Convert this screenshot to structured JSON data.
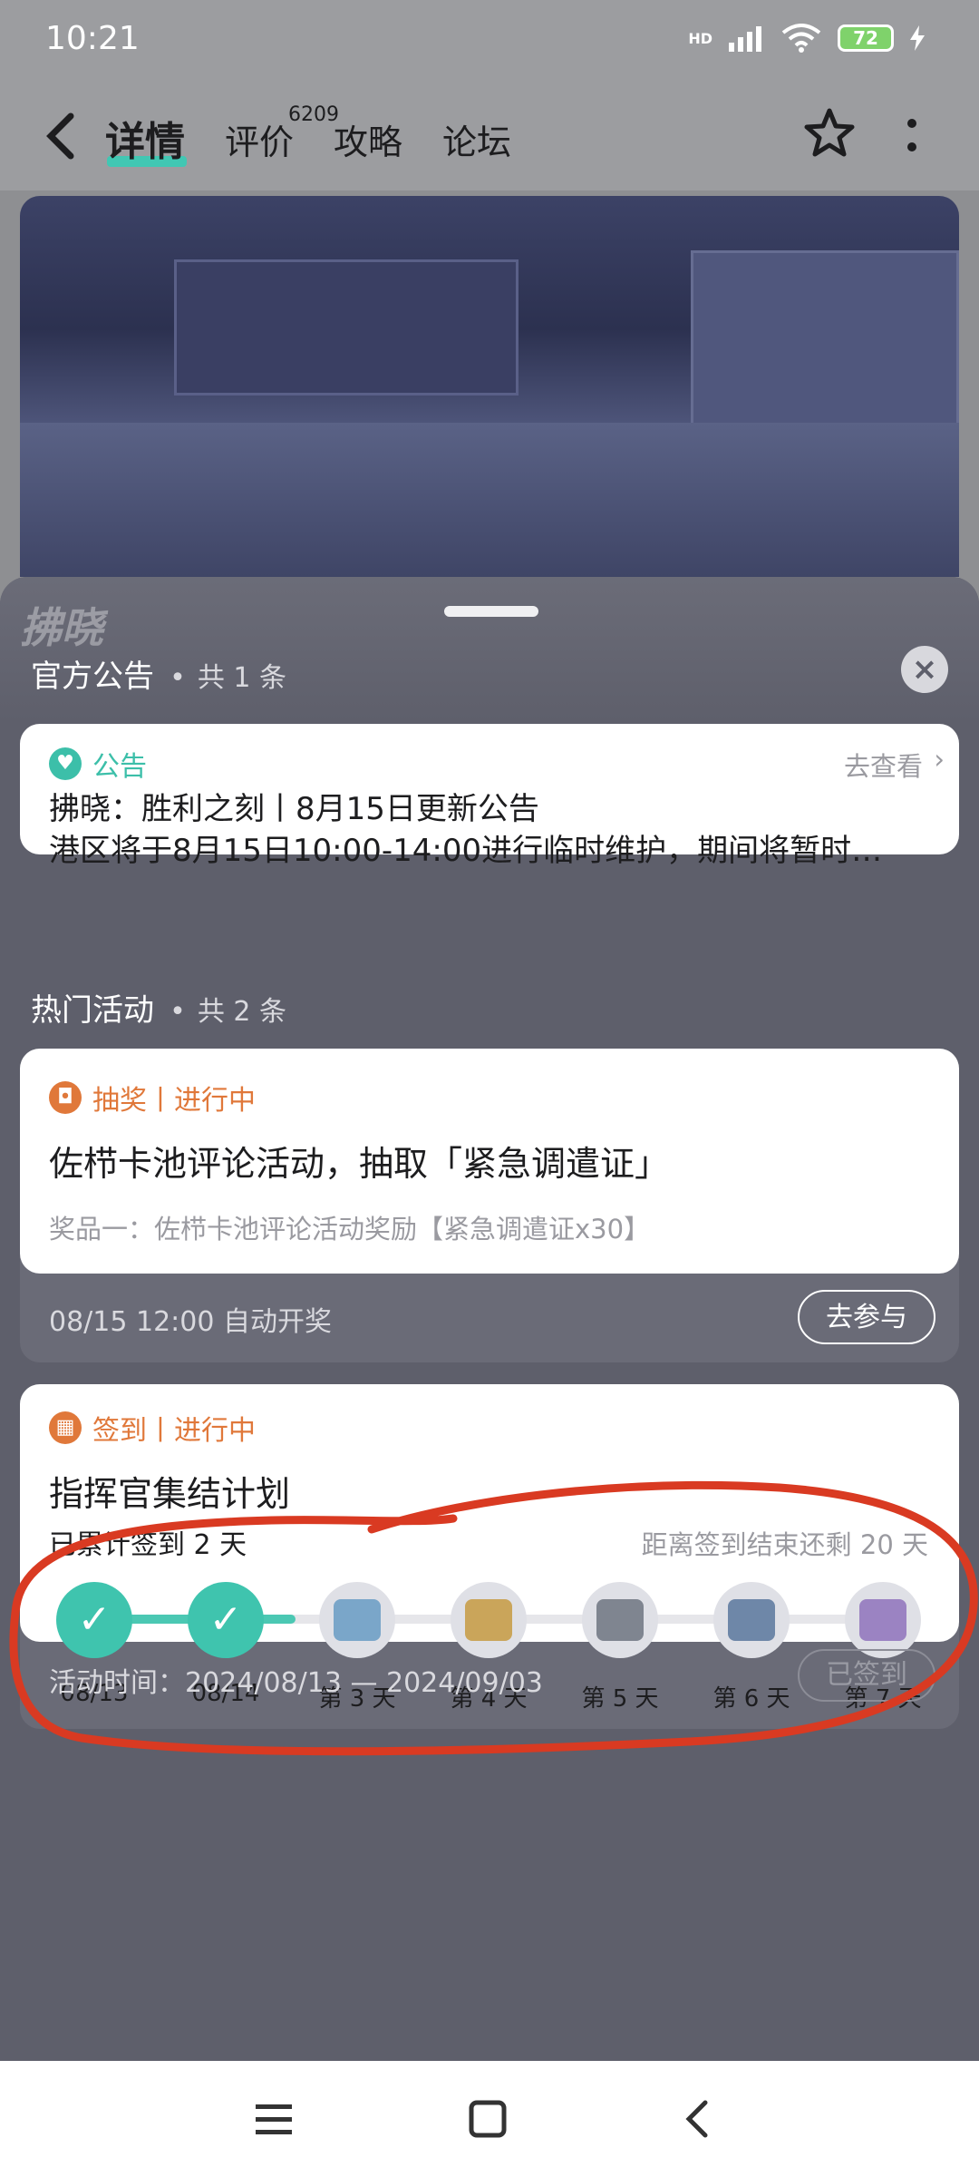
{
  "status_bar": {
    "time": "10:21",
    "battery": "72",
    "network": "HD"
  },
  "nav": {
    "tabs": [
      "详情",
      "评价",
      "攻略",
      "论坛"
    ],
    "review_badge": "6209"
  },
  "watermark": "拂晓",
  "announcements": {
    "title": "官方公告",
    "count": "共 1 条",
    "card": {
      "tag": "公告",
      "link": "去查看",
      "headline": "拂晓：胜利之刻丨8月15日更新公告",
      "summary": "港区将于8月15日10:00-14:00进行临时维护，期间将暂时…"
    }
  },
  "activities": {
    "title": "热门活动",
    "count": "共 2 条",
    "lottery": {
      "tag": "抽奖丨进行中",
      "title": "佐栉卡池评论活动，抽取「紧急调遣证」",
      "prize": "奖品一：佐栉卡池评论活动奖励【紧急调遣证x30】",
      "draw_time": "08/15 12:00 自动开奖",
      "button": "去参与"
    },
    "checkin": {
      "tag": "签到丨进行中",
      "title": "指挥官集结计划",
      "accumulated": "已累计签到 2 天",
      "remaining": "距离签到结束还剩 20 天",
      "days": [
        {
          "label": "08/13",
          "done": true,
          "icon": "check-icon"
        },
        {
          "label": "08/14",
          "done": true,
          "icon": "check-icon"
        },
        {
          "label": "第 3 天",
          "done": false,
          "icon": "card-pack-icon"
        },
        {
          "label": "第 4 天",
          "done": false,
          "icon": "chest-icon"
        },
        {
          "label": "第 5 天",
          "done": false,
          "icon": "ammo-icon"
        },
        {
          "label": "第 6 天",
          "done": false,
          "icon": "ticket-icon"
        },
        {
          "label": "第 7 天",
          "done": false,
          "icon": "gem-bag-icon"
        }
      ],
      "period": "活动时间：2024/08/13 — 2024/09/03",
      "button": "已签到"
    }
  },
  "colors": {
    "accent": "#41c7b3",
    "orange": "#e0783a",
    "annotation": "#d93a22"
  }
}
